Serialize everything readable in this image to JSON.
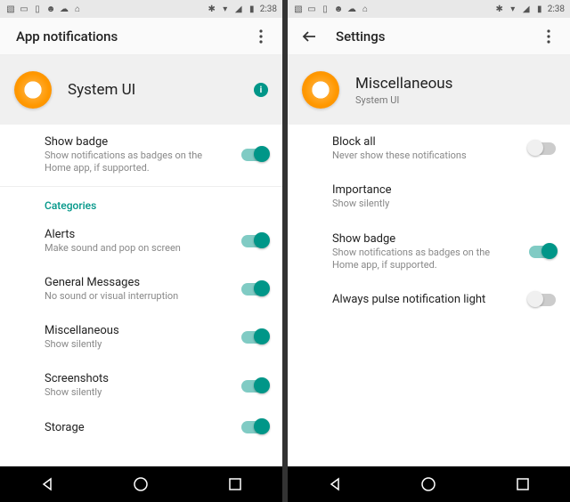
{
  "status": {
    "time": "2:38",
    "icons_left": [
      "picture",
      "rect",
      "tablet",
      "android",
      "cloud",
      "briefcase"
    ],
    "icons_right": [
      "bluetooth",
      "wifi",
      "signal",
      "battery"
    ]
  },
  "left": {
    "appbar_title": "App notifications",
    "header_title": "System UI",
    "rows": {
      "show_badge": {
        "title": "Show badge",
        "sub": "Show notifications as badges on the Home app, if supported.",
        "on": true
      },
      "section": "Categories",
      "alerts": {
        "title": "Alerts",
        "sub": "Make sound and pop on screen",
        "on": true
      },
      "general": {
        "title": "General Messages",
        "sub": "No sound or visual interruption",
        "on": true
      },
      "misc": {
        "title": "Miscellaneous",
        "sub": "Show silently",
        "on": true
      },
      "screenshots": {
        "title": "Screenshots",
        "sub": "Show silently",
        "on": true
      },
      "storage": {
        "title": "Storage",
        "sub": "",
        "on": true
      }
    }
  },
  "right": {
    "appbar_title": "Settings",
    "header_title": "Miscellaneous",
    "header_sub": "System UI",
    "rows": {
      "block_all": {
        "title": "Block all",
        "sub": "Never show these notifications",
        "on": false
      },
      "importance": {
        "title": "Importance",
        "sub": "Show silently"
      },
      "show_badge": {
        "title": "Show badge",
        "sub": "Show notifications as badges on the Home app, if supported.",
        "on": true
      },
      "pulse": {
        "title": "Always pulse notification light",
        "on": false
      }
    }
  }
}
